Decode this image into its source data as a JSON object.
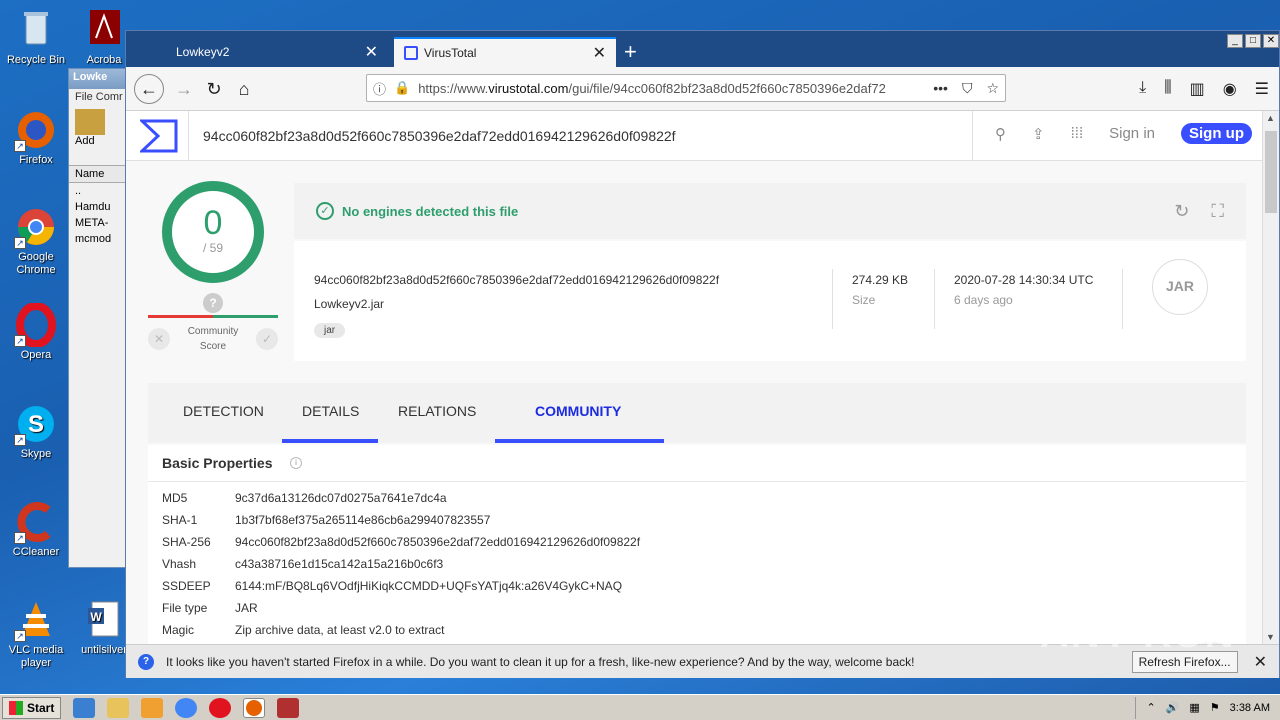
{
  "desktop": {
    "icons": [
      {
        "label": "Recycle Bin",
        "color": "#7aa4cc"
      },
      {
        "label": "Firefox",
        "color": "#e66000"
      },
      {
        "label": "Google Chrome",
        "color": "#4285f4"
      },
      {
        "label": "Opera",
        "color": "#e0131e"
      },
      {
        "label": "Skype",
        "color": "#00aff0"
      },
      {
        "label": "CCleaner",
        "color": "#d0351e"
      },
      {
        "label": "VLC media player",
        "color": "#f48b00"
      }
    ],
    "extra_icons": {
      "acrobat": "Acroba",
      "word_label": "untilsilver"
    }
  },
  "bg_window": {
    "title": "Lowke",
    "menu": "File  Comr",
    "add_label": "Add",
    "col_name": "Name",
    "items": [
      "..",
      "Hamdu",
      "META-",
      "mcmod"
    ]
  },
  "browser": {
    "tabs": [
      {
        "title": "Lowkeyv2"
      },
      {
        "title": "VirusTotal"
      }
    ],
    "url_prefix": "https://www.",
    "url_domain": "virustotal.com",
    "url_path": "/gui/file/94cc060f82bf23a8d0d52f660c7850396e2daf72"
  },
  "vt": {
    "search_hash": "94cc060f82bf23a8d0d52f660c7850396e2daf72edd016942129626d0f09822f",
    "sign_in": "Sign in",
    "sign_up": "Sign up",
    "score": {
      "detections": "0",
      "total": "/ 59",
      "qmark": "?",
      "community_label_1": "Community",
      "community_label_2": "Score"
    },
    "banner": "No engines detected this file",
    "file": {
      "hash": "94cc060f82bf23a8d0d52f660c7850396e2daf72edd016942129626d0f09822f",
      "name": "Lowkeyv2.jar",
      "tag": "jar",
      "size": "274.29 KB",
      "size_label": "Size",
      "date": "2020-07-28 14:30:34 UTC",
      "date_ago": "6 days ago",
      "type_icon_text": "JAR"
    },
    "tabs": [
      "DETECTION",
      "DETAILS",
      "RELATIONS",
      "COMMUNITY"
    ],
    "selected_tab": "COMMUNITY",
    "basic_properties_title": "Basic Properties",
    "properties": [
      {
        "k": "MD5",
        "v": "9c37d6a13126dc07d0275a7641e7dc4a"
      },
      {
        "k": "SHA-1",
        "v": "1b3f7bf68ef375a265114e86cb6a299407823557"
      },
      {
        "k": "SHA-256",
        "v": "94cc060f82bf23a8d0d52f660c7850396e2daf72edd016942129626d0f09822f"
      },
      {
        "k": "Vhash",
        "v": "c43a38716e1d15ca142a15a216b0c6f3"
      },
      {
        "k": "SSDEEP",
        "v": "6144:mF/BQ8Lq6VOdfjHiKiqkCCMDD+UQFsYATjq4k:a26V4GykC+NAQ"
      },
      {
        "k": "File type",
        "v": "JAR"
      },
      {
        "k": "Magic",
        "v": "Zip archive data, at least v2.0 to extract"
      }
    ]
  },
  "notification": {
    "text": "It looks like you haven't started Firefox in a while. Do you want to clean it up for a fresh, like-new experience? And by the way, welcome back!",
    "button": "Refresh Firefox..."
  },
  "watermark": "ANY RUN",
  "taskbar": {
    "start": "Start",
    "clock": "3:38 AM"
  }
}
